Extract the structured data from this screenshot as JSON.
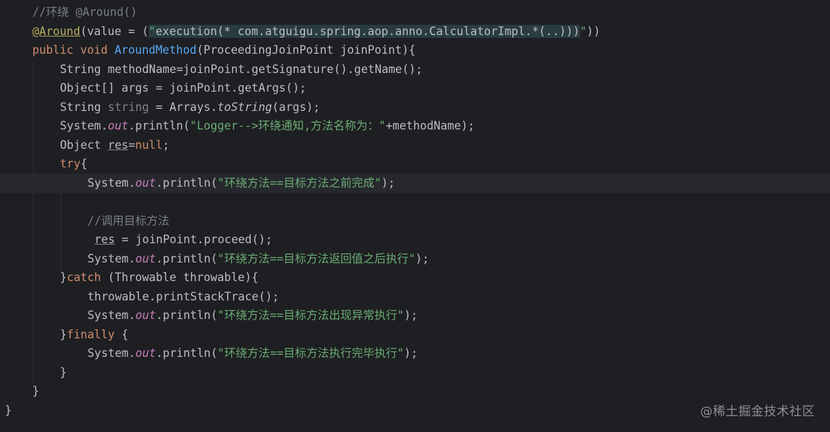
{
  "code": {
    "l1_comment": "//环绕 @Around()",
    "l2_at": "@Around",
    "l2_a": "(value = (",
    "l2_q1": "\"",
    "l2_exec": "execution",
    "l2_mid": "(* com.atguigu.spring.aop.anno.CalculatorImpl.*(..)))",
    "l2_q2": "\"",
    "l2_end": "))",
    "l3_public": "public",
    "l3_void": "void",
    "l3_name": "AroundMethod",
    "l3_params": "(ProceedingJoinPoint joinPoint){",
    "l4": "String methodName=joinPoint.getSignature().getName();",
    "l5": "Object[] args = joinPoint.getArgs();",
    "l6_type": "String",
    "l6_var": "string",
    "l6_eq": " = Arrays.",
    "l6_method": "toString",
    "l6_end": "(args);",
    "l7_sys": "System.",
    "l7_out": "out",
    "l7_print": ".println(",
    "l7_str": "\"Logger-->环绕通知,方法名称为：\"",
    "l7_end": "+methodName);",
    "l8_type": "Object",
    "l8_var": "res",
    "l8_eq": "=",
    "l8_null": "null",
    "l8_end": ";",
    "l9_try": "try",
    "l9_brace": "{",
    "l10_sys": "System.",
    "l10_out": "out",
    "l10_print": ".println(",
    "l10_str": "\"环绕方法==目标方法之前完成\"",
    "l10_end": ");",
    "l12_comment": "//调用目标方法",
    "l13_var": "res",
    "l13_rest": " = joinPoint.proceed();",
    "l14_sys": "System.",
    "l14_out": "out",
    "l14_print": ".println(",
    "l14_str": "\"环绕方法==目标方法返回值之后执行\"",
    "l14_end": ");",
    "l15_brace": "}",
    "l15_catch": "catch",
    "l15_rest": " (Throwable throwable){",
    "l16": "throwable.printStackTrace();",
    "l17_sys": "System.",
    "l17_out": "out",
    "l17_print": ".println(",
    "l17_str": "\"环绕方法==目标方法出现异常执行\"",
    "l17_end": ");",
    "l18_brace": "}",
    "l18_finally": "finally",
    "l18_rest": " {",
    "l19_sys": "System.",
    "l19_out": "out",
    "l19_print": ".println(",
    "l19_str": "\"环绕方法==目标方法执行完毕执行\"",
    "l19_end": ");",
    "l20": "}",
    "l21": "}",
    "l22": "}"
  },
  "watermark": "@稀土掘金技术社区",
  "colors": {
    "background": "#1e1f22",
    "current_line": "#26282e",
    "keyword": "#cf8e6d",
    "string": "#6aab73",
    "comment": "#7a7e85",
    "annotation": "#b3ae60",
    "method_declaration": "#56a8f5",
    "static_field": "#c77dbb",
    "default_text": "#bcbec4"
  }
}
